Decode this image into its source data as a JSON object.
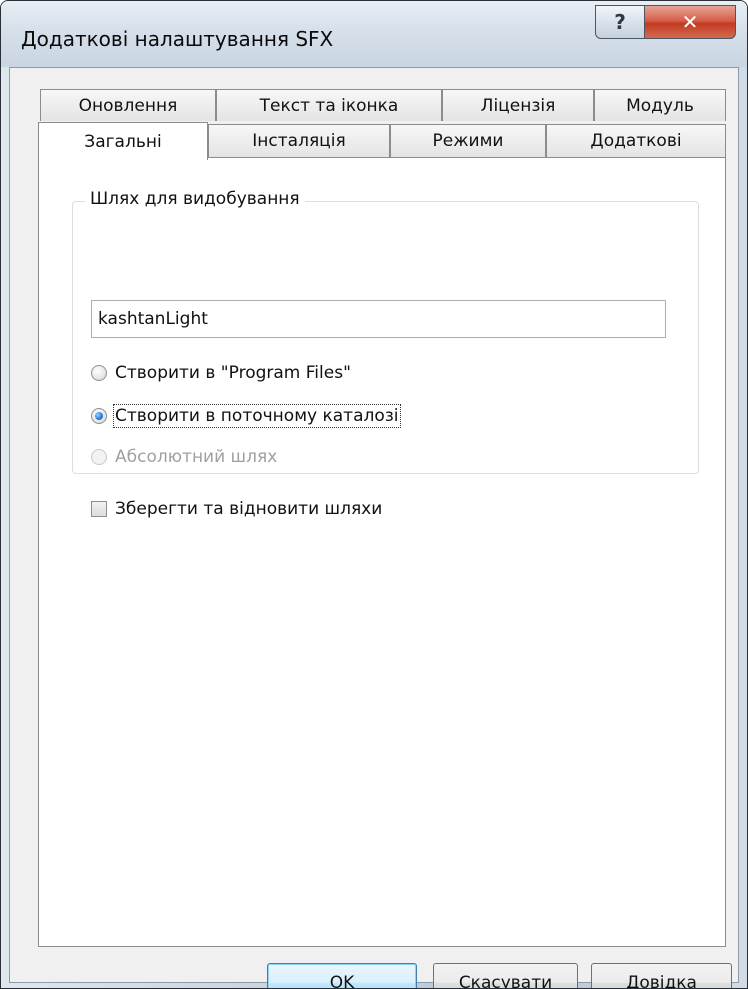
{
  "window": {
    "title": "Додаткові налаштування SFX",
    "help_glyph": "?",
    "close_glyph": "✕"
  },
  "tabs": {
    "back_row": [
      "Оновлення",
      "Текст та іконка",
      "Ліцензія",
      "Модуль"
    ],
    "front_row": [
      "Загальні",
      "Інсталяція",
      "Режими",
      "Додаткові"
    ],
    "active": "Загальні"
  },
  "extraction_path": {
    "group_title": "Шлях для видобування",
    "value": "kashtanLight",
    "options": [
      {
        "label": "Створити в \"Program Files\"",
        "checked": false,
        "enabled": true
      },
      {
        "label": "Створити в поточному каталозі",
        "checked": true,
        "enabled": true
      },
      {
        "label": "Абсолютний шлях",
        "checked": false,
        "enabled": false
      }
    ],
    "save_restore_label": "Зберегти та відновити шляхи",
    "save_restore_checked": false
  },
  "buttons": {
    "ok": "OK",
    "cancel": "Скасувати",
    "help": "Довідка"
  }
}
